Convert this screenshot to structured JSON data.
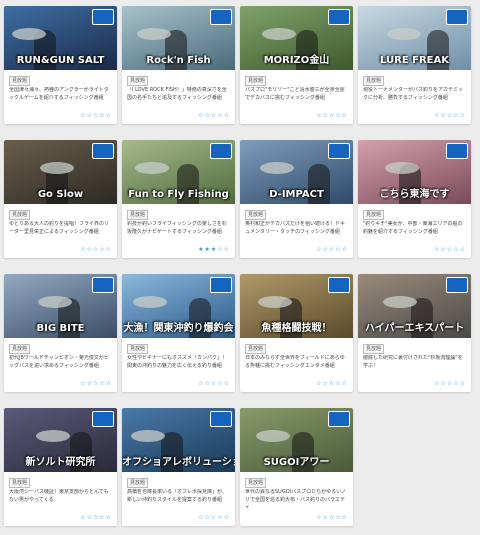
{
  "badge_label": "見放題",
  "programs": [
    {
      "title": "RUN&GUN SALT",
      "desc": "全国津々浦々、熱種のアングラーがライトタックルゲームを紹介するフィッシング番組",
      "stars": "☆☆☆☆☆",
      "colors": [
        "#1b2a4a",
        "#3e6fa3"
      ]
    },
    {
      "title": "Rock'n Fish",
      "desc": "「I LOVE ROCK FISH！」特務の真深さを全国の名手たちと追及するフィッシング番組",
      "stars": "☆☆☆☆☆",
      "colors": [
        "#4a6a7a",
        "#a7c2cc"
      ]
    },
    {
      "title": "MORIZO金山",
      "desc": "バスプロ\"モリゾー\"こと清水盛三が全身全霊でデカバスに挑むフィッシング番組",
      "stars": "☆☆☆☆☆",
      "colors": [
        "#3f5a2e",
        "#7fa36a"
      ]
    },
    {
      "title": "LURE FREAK",
      "desc": "現役トーナメンターがバス釣りをアカデミックに分析、勝負するフィッシング番組",
      "stars": "☆☆☆☆☆",
      "colors": [
        "#6e8fa8",
        "#c9d8e2"
      ]
    },
    {
      "title": "Go Slow",
      "desc": "ゆとりある大人の釣りを提唱！フライ界のリーダー里見栄正によるフィッシング番組",
      "stars": "☆☆☆☆☆",
      "colors": [
        "#2c2a26",
        "#6b5e4a"
      ]
    },
    {
      "title": "Fun to Fly Fishing",
      "desc": "釣技が釣いフライフィッシングの楽しさを杉坂隆久がナビゲートするフィッシング番組",
      "stars": "★★★☆☆",
      "colors": [
        "#4f6b3c",
        "#a7b98c"
      ]
    },
    {
      "title": "D-IMPACT",
      "desc": "奥村和正がデカバスだけを狙い続ける！ドキュメンタリー・タッチのフィッシング番組",
      "stars": "☆☆☆☆☆",
      "colors": [
        "#2f4a6a",
        "#7f9ebb"
      ]
    },
    {
      "title": "こちら東海です",
      "desc": "\"釣りキチ\"美女が、中部・東海エリアの船の釣魅を紹介するフィッシング番組",
      "stars": "☆☆☆☆☆",
      "colors": [
        "#7a4a5a",
        "#d4a0ac"
      ]
    },
    {
      "title": "BIG BITE",
      "desc": "初代JBワールドチャンピオン・菊元俊文がビッグバスを追い求めるフィッシング番組",
      "stars": "☆☆☆☆☆",
      "colors": [
        "#3a4e66",
        "#93a9c2"
      ]
    },
    {
      "title": "大漁！関東沖釣り爆釣会",
      "desc": "女性やビギナーにもオススメ「カンパク」！関東の沖釣りの魅力を広く伝える釣り番組",
      "stars": "☆☆☆☆☆",
      "colors": [
        "#2a5a8a",
        "#8cb8dc"
      ]
    },
    {
      "title": "魚種格闘技戦！",
      "desc": "日本のみならず全世界をフィールドにあらゆる魚種に挑むフィッシングエンタメ番組",
      "stars": "☆☆☆☆☆",
      "colors": [
        "#5a4a2a",
        "#b09a6a"
      ]
    },
    {
      "title": "ハイパーエキスパート",
      "desc": "徹底した研究に裏付けされた\"杉坂流理論\"を学ぶ！",
      "stars": "☆☆☆☆☆",
      "colors": [
        "#4a4a4a",
        "#9a8a7a"
      ]
    },
    {
      "title": "新ソルト研究所",
      "desc": "大阪湾シーバス機証！東京支部からとんでもない男がやってくる。",
      "stars": "☆☆☆☆☆",
      "colors": [
        "#2a2a3a",
        "#5a5a7a"
      ]
    },
    {
      "title": "オフショアレボリューション",
      "desc": "高橋哲也隊長率いる「オフレボ探見隊」が、新しい沖釣りスタイルを提案する釣り番組",
      "stars": "☆☆☆☆☆",
      "colors": [
        "#1a3a5a",
        "#4a7aa8"
      ]
    },
    {
      "title": "SUGOIアワー",
      "desc": "世代の異なるSUGOIバスプロたちがゆるいノリで全国を巡る釣大布・バス釣りのバラエティ",
      "stars": "☆☆☆☆☆",
      "colors": [
        "#4a5a3a",
        "#8a9a6a"
      ]
    }
  ]
}
